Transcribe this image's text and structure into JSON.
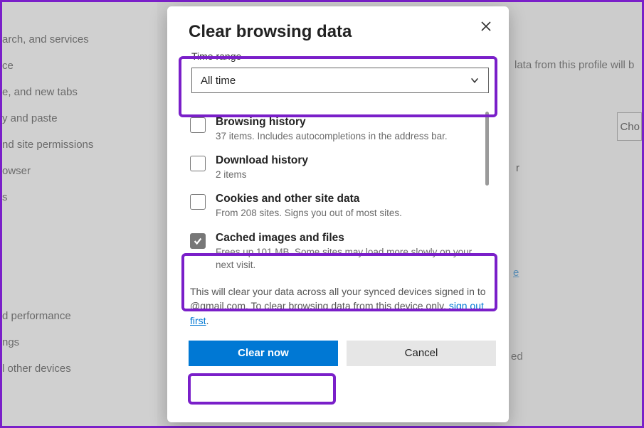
{
  "sidebar": {
    "items": [
      "arch, and services",
      "ce",
      "e, and new tabs",
      "y and paste",
      "nd site permissions",
      "owser",
      "s",
      "",
      "",
      "",
      "d performance",
      "ngs",
      "l other devices"
    ]
  },
  "bg": {
    "profile_text": "lata from this profile will b",
    "choose_label": "Cho",
    "r_fragment": "r",
    "signout_fragment": "e",
    "ed_fragment": "ed"
  },
  "dialog": {
    "title": "Clear browsing data",
    "time_range_label": "Time range",
    "time_range_value": "All time",
    "options": [
      {
        "title": "Browsing history",
        "sub": "37 items. Includes autocompletions in the address bar.",
        "checked": false
      },
      {
        "title": "Download history",
        "sub": "2 items",
        "checked": false
      },
      {
        "title": "Cookies and other site data",
        "sub": "From 208 sites. Signs you out of most sites.",
        "checked": false
      },
      {
        "title": "Cached images and files",
        "sub": "Frees up 101 MB. Some sites may load more slowly on your next visit.",
        "checked": true
      }
    ],
    "sync_note_pre": "This will clear your data across all your synced devices signed in to ",
    "sync_note_mid": "@gmail.com. To clear browsing data from this device only, ",
    "sync_note_link": "sign out first",
    "sync_note_post": ".",
    "clear_label": "Clear now",
    "cancel_label": "Cancel"
  }
}
